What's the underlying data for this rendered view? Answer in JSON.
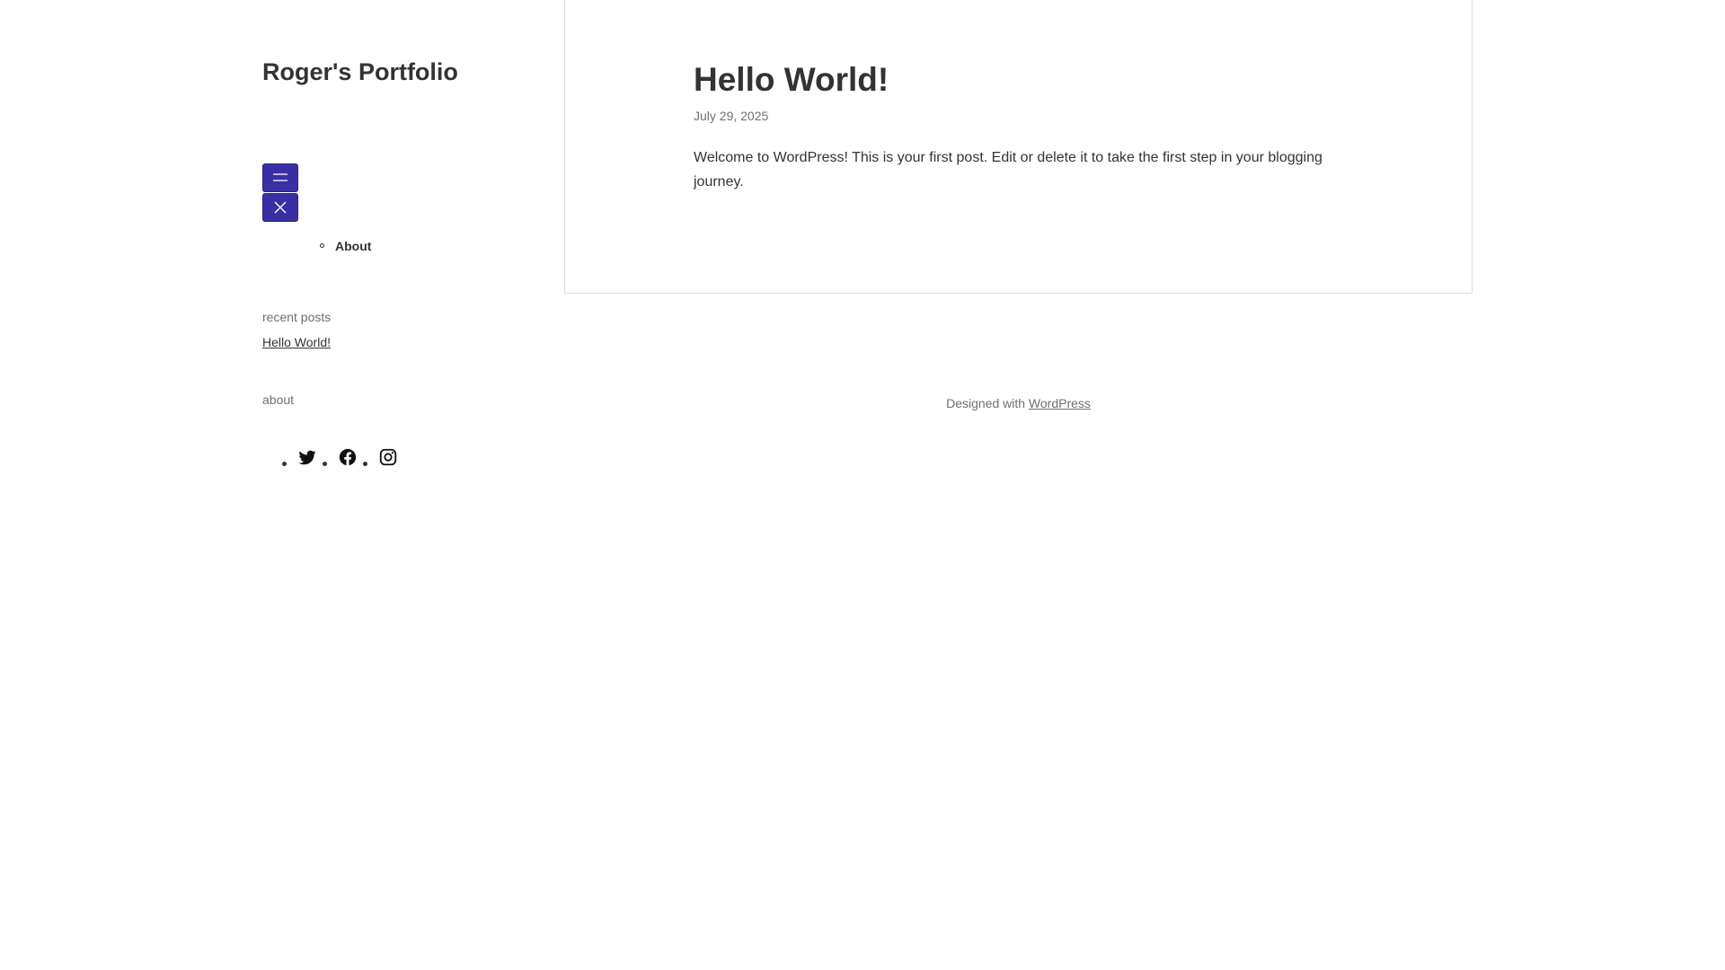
{
  "site": {
    "title": "Roger's Portfolio"
  },
  "navigation": {
    "items": [
      {
        "label": "About"
      }
    ],
    "toggle_color": "#3b2fa6"
  },
  "sidebar": {
    "recent_posts_heading": "recent posts",
    "recent_posts": [
      {
        "title": "Hello World!"
      }
    ],
    "about_heading": "about",
    "social_icons": [
      "twitter-icon",
      "facebook-icon",
      "instagram-icon"
    ]
  },
  "post": {
    "title": "Hello World!",
    "date": "July 29, 2025",
    "body": "Welcome to WordPress! This is your first post. Edit or delete it to take the first step in your blogging journey."
  },
  "footer": {
    "prefix": "Designed with",
    "link_label": "WordPress"
  }
}
